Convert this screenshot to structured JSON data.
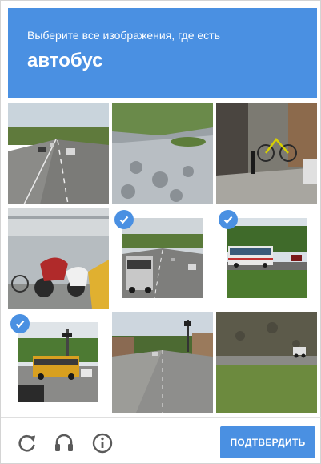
{
  "header": {
    "instruction": "Выберите все изображения, где есть",
    "target": "автобус"
  },
  "tiles": [
    {
      "scene": "highway-traffic",
      "selected": false
    },
    {
      "scene": "sidewalk-shadows",
      "selected": false
    },
    {
      "scene": "bicycle-rack",
      "selected": false
    },
    {
      "scene": "parked-motorcycles",
      "selected": false
    },
    {
      "scene": "road-with-bus",
      "selected": true
    },
    {
      "scene": "bus-by-park",
      "selected": true
    },
    {
      "scene": "school-bus-intersection",
      "selected": true
    },
    {
      "scene": "city-street",
      "selected": false
    },
    {
      "scene": "road-stone-wall",
      "selected": false
    }
  ],
  "footer": {
    "reload_icon": "reload-icon",
    "audio_icon": "headphones-icon",
    "info_icon": "info-icon",
    "verify_label": "ПОДТВЕРДИТЬ"
  },
  "colors": {
    "accent": "#4a90e2"
  }
}
